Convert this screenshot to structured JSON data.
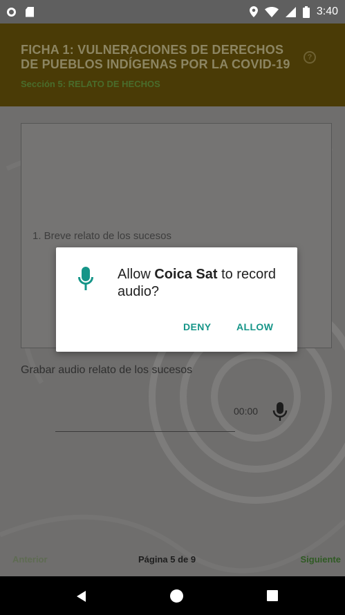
{
  "status_bar": {
    "time": "3:40",
    "icons": [
      "notification-circle-icon",
      "sd-card-icon",
      "location-icon",
      "wifi-icon",
      "signal-icon",
      "battery-icon"
    ]
  },
  "header": {
    "title": "FICHA 1: VULNERACIONES DE DERECHOS DE PUEBLOS INDÍGENAS POR LA COVID-19",
    "subtitle": "Sección 5: RELATO DE HECHOS",
    "help_icon_glyph": "?"
  },
  "form": {
    "textarea_label": "1. Breve relato de los sucesos",
    "audio_label": "Grabar audio relato de los sucesos",
    "audio_time": "00:00"
  },
  "footer": {
    "prev_label": "Anterior",
    "page_indicator": "Página 5 de 9",
    "next_label": "Siguiente"
  },
  "dialog": {
    "message_prefix": "Allow ",
    "app_name": "Coica Sat",
    "message_suffix": " to record audio?",
    "deny_label": "DENY",
    "allow_label": "ALLOW",
    "icon_color": "#159588"
  },
  "colors": {
    "header_bg": "#4a3b06",
    "accent_green": "#159588",
    "scrim_bg": "#6f6e6d"
  }
}
